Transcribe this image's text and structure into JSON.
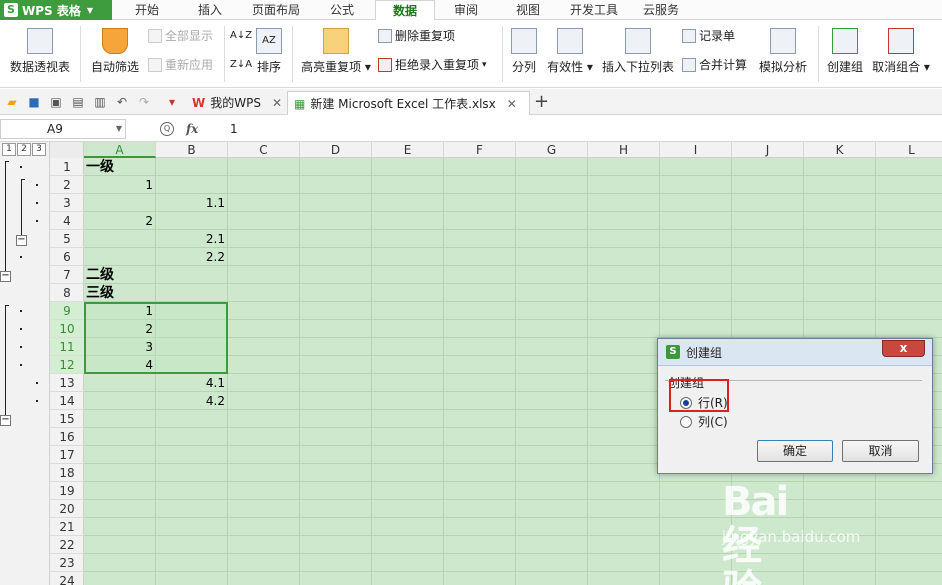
{
  "app": {
    "name": "WPS 表格",
    "logo_letter": "S"
  },
  "menu_tabs": [
    "开始",
    "插入",
    "页面布局",
    "公式",
    "数据",
    "审阅",
    "视图",
    "开发工具",
    "云服务"
  ],
  "active_tab": "数据",
  "ribbon": {
    "pivot": "数据透视表",
    "autofilter": "自动筛选",
    "show_all": "全部显示",
    "reapply": "重新应用",
    "sort": "排序",
    "highlight_dup": "高亮重复项",
    "remove_dup": "删除重复项",
    "reject_dup": "拒绝录入重复项",
    "split": "分列",
    "validity": "有效性",
    "insert_dropdown": "插入下拉列表",
    "record_sheet": "记录单",
    "merge_calc": "合并计算",
    "simulate": "模拟分析",
    "create_group": "创建组",
    "ungroup": "取消组合",
    "sort_asc_glyph": "A↓Z",
    "sort_desc_glyph": "Z↓A",
    "az_glyph": "AZ"
  },
  "doc_tabs": [
    {
      "label": "我的WPS"
    },
    {
      "label": "新建 Microsoft Excel 工作表.xlsx"
    }
  ],
  "formula_bar": {
    "name_box": "A9",
    "formula": "1",
    "fx": "fx",
    "zoom_icon": "Q"
  },
  "outline_levels": [
    "1",
    "2",
    "3"
  ],
  "outline_collapse_glyph": "−",
  "columns": [
    "A",
    "B",
    "C",
    "D",
    "E",
    "F",
    "G",
    "H",
    "I",
    "J",
    "K",
    "L"
  ],
  "rows": [
    "1",
    "2",
    "3",
    "4",
    "5",
    "6",
    "7",
    "8",
    "9",
    "10",
    "11",
    "12",
    "13",
    "14",
    "15",
    "16",
    "17",
    "18",
    "19",
    "20",
    "21",
    "22",
    "23",
    "24"
  ],
  "cells": {
    "A1": "一级",
    "A2": "1",
    "B3": "1.1",
    "A4": "2",
    "B5": "2.1",
    "B6": "2.2",
    "A7": "二级",
    "A8": "三级",
    "A9": "1",
    "A10": "2",
    "A11": "3",
    "A12": "4",
    "B13": "4.1",
    "B14": "4.2"
  },
  "dialog": {
    "title": "创建组",
    "icon_letter": "S",
    "close": "x",
    "group_label": "创建组",
    "option_row": "行(R)",
    "option_col": "列(C)",
    "selected": "行(R)",
    "ok": "确定",
    "cancel": "取消"
  },
  "watermark": {
    "logo": "Bai 经验",
    "url": "jingyan.baidu.com"
  },
  "colors": {
    "accent": "#3e9b3e",
    "sheet_bg": "#cde8cc",
    "highlight": "#e02020"
  }
}
